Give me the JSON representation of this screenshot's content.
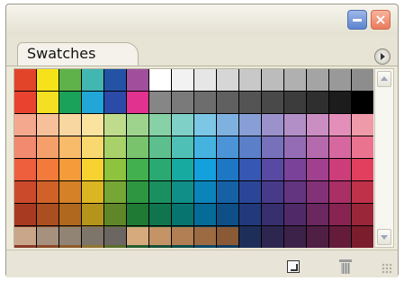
{
  "panel": {
    "tab_label": "Swatches"
  },
  "icons": {
    "minimize": "minimize-icon",
    "close": "close-icon",
    "menu": "panel-menu-icon",
    "new_swatch": "new-swatch-icon",
    "delete": "trash-icon"
  },
  "swatches": {
    "rows": [
      [
        "#e2442a",
        "#f6e21a",
        "#5fb24a",
        "#42b6b0",
        "#2453a5",
        "#a14f9d",
        "#ffffff",
        "#f2f2f2",
        "#e6e6e6",
        "#d6d6d6",
        "#c8c8c8",
        "#bcbcbc",
        "#b0b0b0",
        "#a4a4a4",
        "#999999",
        "#8d8d8d"
      ],
      [
        "#e94330",
        "#f4df22",
        "#1aa25a",
        "#22a6d8",
        "#2c4aa8",
        "#e0328e",
        "#868686",
        "#7a7a7a",
        "#6d6d6d",
        "#606060",
        "#545454",
        "#494949",
        "#3c3c3c",
        "#2f2f2f",
        "#1c1c1c",
        "#000000"
      ],
      [
        "#f4a98f",
        "#f7c09a",
        "#f9d7a0",
        "#fae39e",
        "#bfdc8d",
        "#9ed38d",
        "#86d1a5",
        "#7fd1c7",
        "#7cc6e6",
        "#7fb1e0",
        "#889ed6",
        "#9b91cb",
        "#b38fc7",
        "#cb8ec2",
        "#e38fb9",
        "#ef9aa8"
      ],
      [
        "#f28a6f",
        "#f5a06a",
        "#f7bb6a",
        "#f9d96f",
        "#a8d169",
        "#79c36c",
        "#5dbf8e",
        "#4fc0b6",
        "#45b3e0",
        "#4b94d7",
        "#5b7fc8",
        "#7770bb",
        "#946cb5",
        "#b46aac",
        "#d7689f",
        "#ea7490"
      ],
      [
        "#ee5f3e",
        "#f27b3b",
        "#f59c3a",
        "#f8d231",
        "#8ec33e",
        "#42b04e",
        "#2aaa72",
        "#17aaa0",
        "#14a0dc",
        "#1e77c5",
        "#3657b3",
        "#5849a3",
        "#7a4399",
        "#a1408f",
        "#cd3d7a",
        "#e23f5e"
      ],
      [
        "#cc4a2c",
        "#d06229",
        "#d48127",
        "#dab623",
        "#76a635",
        "#2e9640",
        "#1a9060",
        "#0f8f88",
        "#0a84b9",
        "#1661a6",
        "#2b4697",
        "#473a89",
        "#633580",
        "#843277",
        "#a92f65",
        "#bf3148"
      ],
      [
        "#a83a22",
        "#ab4f20",
        "#af681e",
        "#b4941b",
        "#5f8729",
        "#1f7a33",
        "#10754e",
        "#087470",
        "#056b97",
        "#0e4f88",
        "#22397b",
        "#382f6f",
        "#502a68",
        "#6a2760",
        "#882451",
        "#9a2639"
      ],
      [
        "#8a3a28",
        "#8c4a29",
        "#8f5b2b",
        "#927533",
        "#5a6f2c",
        "#245f2f",
        "#174f38",
        "#0c4d4b",
        "#0a4a66",
        "#0f3d60",
        "#1d2f58",
        "#2d2750",
        "#3c2249",
        "#4f1f44",
        "#651c3b",
        "#7b1d2c"
      ]
    ],
    "last_row": [
      "#c9a689",
      "#a6907e",
      "#918474",
      "#7d746a",
      "#6b6661",
      "#d6aa7c",
      "#c49366",
      "#b27e53",
      "#9c6b42",
      "#895a35"
    ]
  }
}
